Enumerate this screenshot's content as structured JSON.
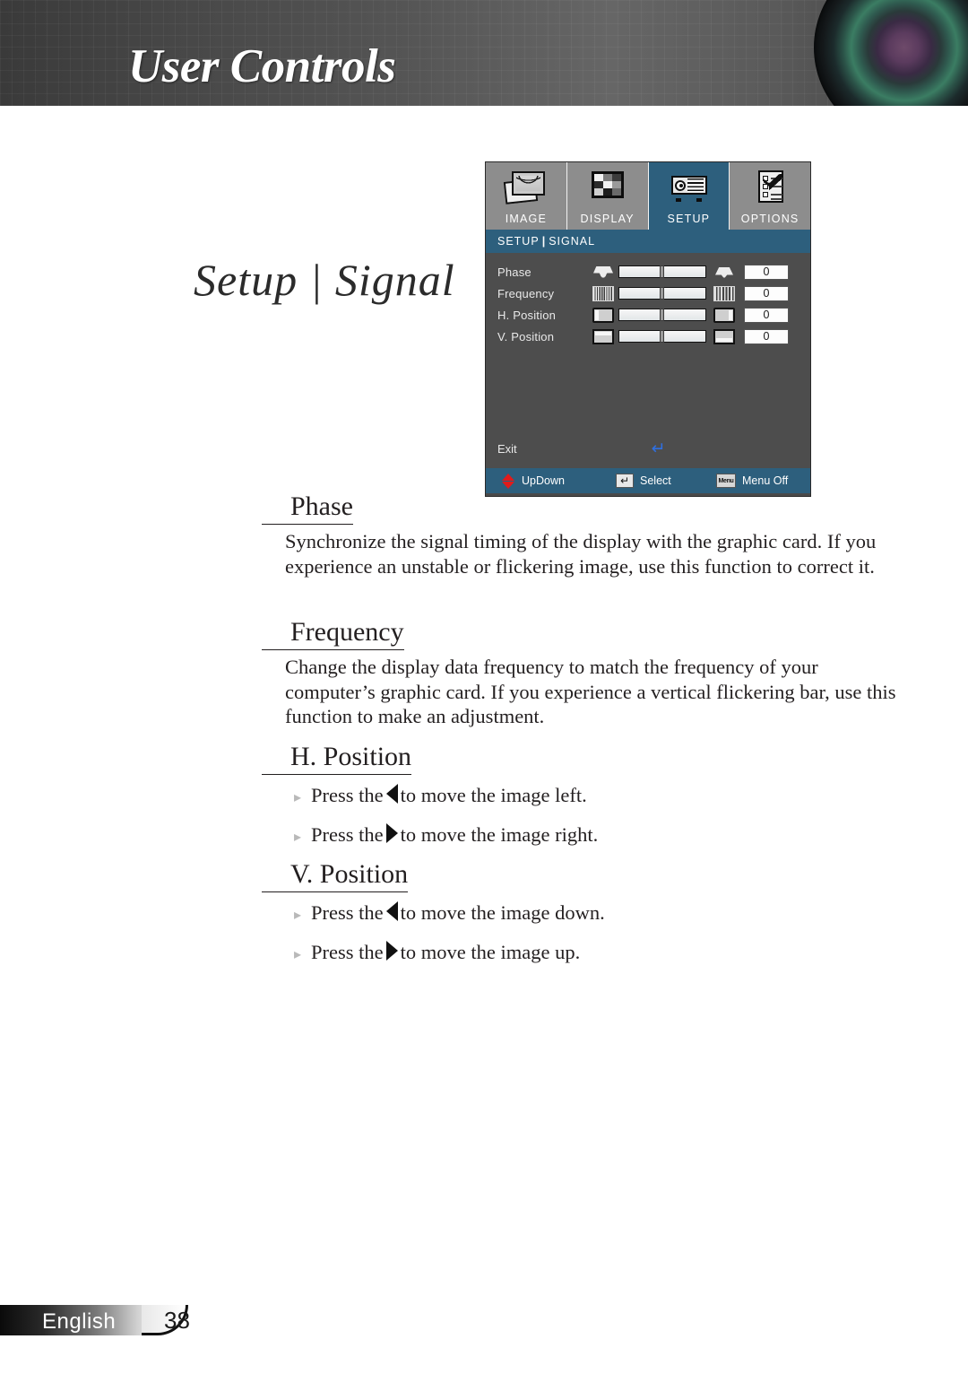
{
  "header": {
    "title": "User Controls",
    "lens_icon": "camera-lens-graphic"
  },
  "page_title": "Setup | Signal",
  "osd": {
    "tabs": [
      {
        "label": "IMAGE",
        "icon": "image-icon",
        "active": false
      },
      {
        "label": "DISPLAY",
        "icon": "display-icon",
        "active": false
      },
      {
        "label": "SETUP",
        "icon": "setup-projector-icon",
        "active": true
      },
      {
        "label": "OPTIONS",
        "icon": "options-checklist-icon",
        "active": false
      }
    ],
    "breadcrumb": {
      "parent": "SETUP",
      "separator": "|",
      "child": "SIGNAL"
    },
    "rows": [
      {
        "label": "Phase",
        "left_icon": "keystone-icon",
        "right_icon": "keystone-narrow-icon",
        "value": "0"
      },
      {
        "label": "Frequency",
        "left_icon": "fine-grid-icon",
        "right_icon": "coarse-grid-icon",
        "value": "0"
      },
      {
        "label": "H. Position",
        "left_icon": "h-shift-left-icon",
        "right_icon": "h-shift-right-icon",
        "value": "0"
      },
      {
        "label": "V. Position",
        "left_icon": "v-shift-up-icon",
        "right_icon": "v-shift-down-icon",
        "value": "0"
      }
    ],
    "exit_label": "Exit",
    "exit_glyph": "↵",
    "footer_items": [
      {
        "icon": "up-down-arrows-icon",
        "label": "UpDown",
        "key": ""
      },
      {
        "icon": "enter-key-icon",
        "label": "Select",
        "key": "↵"
      },
      {
        "icon": "menu-key-icon",
        "label": "Menu Off",
        "key": "Menu"
      }
    ],
    "accent_blue": "#2d5f7d",
    "accent_red": "#e01b1b",
    "panel_gray": "#4d4d4d"
  },
  "sections": [
    {
      "heading": "Phase",
      "body": "Synchronize the signal timing of the display with the graphic card. If you experience an unstable or flickering image, use this function to correct it."
    },
    {
      "heading": "Frequency",
      "body": "Change the display data frequency to match the frequency of your computer’s graphic card. If you experience a vertical flickering bar, use this function to make an adjustment."
    },
    {
      "heading": "H. Position",
      "bullets": [
        {
          "pre": "Press the",
          "arrow": "left",
          "post": "to move the image left."
        },
        {
          "pre": "Press the",
          "arrow": "right",
          "post": "to move the image right."
        }
      ]
    },
    {
      "heading": "V. Position",
      "bullets": [
        {
          "pre": "Press the",
          "arrow": "left",
          "post": "to move the image down."
        },
        {
          "pre": "Press the",
          "arrow": "right",
          "post": "to move the image up."
        }
      ]
    }
  ],
  "footer": {
    "language": "English",
    "page_number": "38"
  }
}
